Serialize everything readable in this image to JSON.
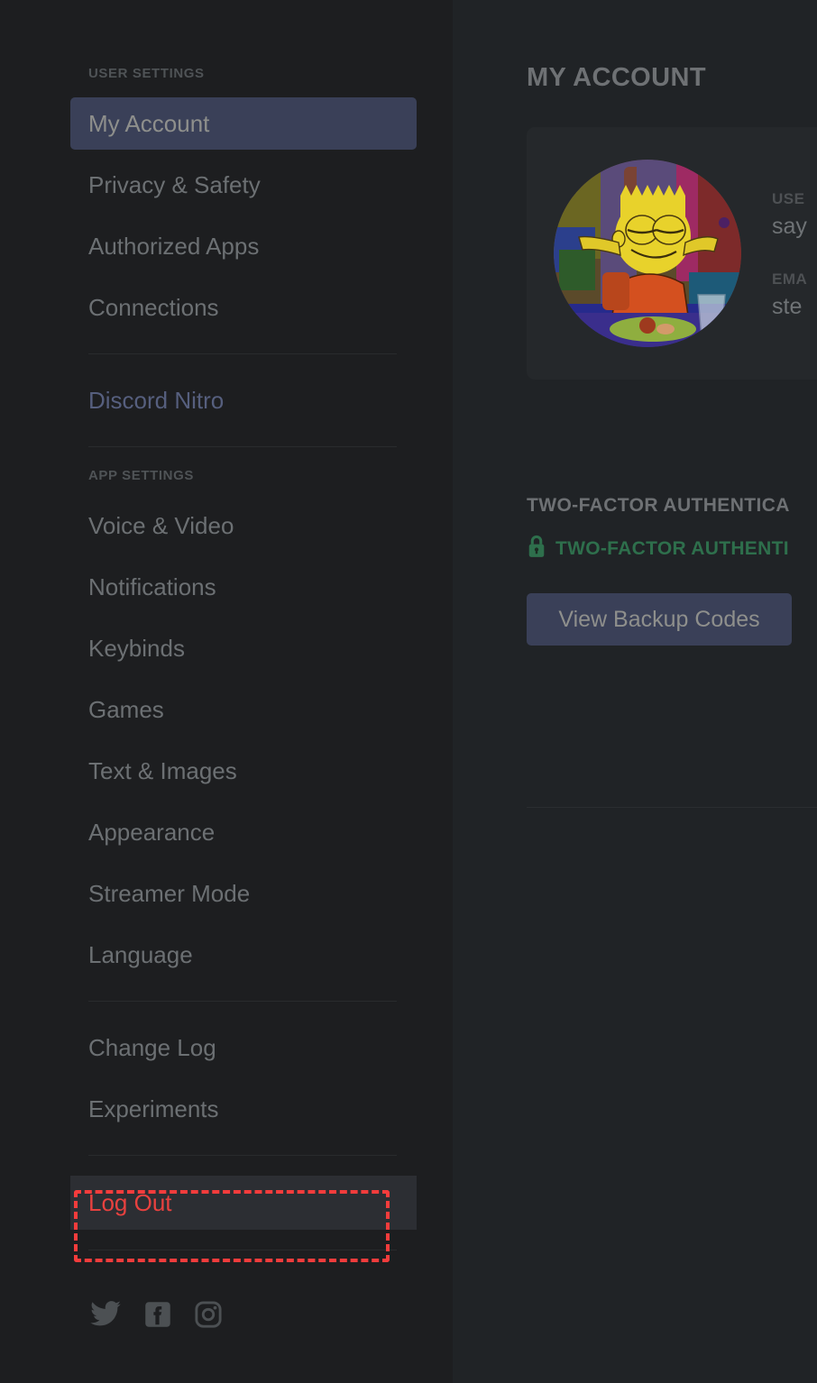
{
  "sidebar": {
    "user_settings_header": "USER SETTINGS",
    "user_settings_items": [
      {
        "label": "My Account",
        "selected": true
      },
      {
        "label": "Privacy & Safety",
        "selected": false
      },
      {
        "label": "Authorized Apps",
        "selected": false
      },
      {
        "label": "Connections",
        "selected": false
      }
    ],
    "nitro_label": "Discord Nitro",
    "app_settings_header": "APP SETTINGS",
    "app_settings_items": [
      {
        "label": "Voice & Video"
      },
      {
        "label": "Notifications"
      },
      {
        "label": "Keybinds"
      },
      {
        "label": "Games"
      },
      {
        "label": "Text & Images"
      },
      {
        "label": "Appearance"
      },
      {
        "label": "Streamer Mode"
      },
      {
        "label": "Language"
      }
    ],
    "misc_items": [
      {
        "label": "Change Log"
      },
      {
        "label": "Experiments"
      }
    ],
    "logout_label": "Log Out",
    "socials": [
      {
        "name": "twitter-icon"
      },
      {
        "name": "facebook-icon"
      },
      {
        "name": "instagram-icon"
      }
    ]
  },
  "main": {
    "title": "MY ACCOUNT",
    "account": {
      "username_label": "USE",
      "username_value": "say",
      "email_label": "EMA",
      "email_value": "ste",
      "avatar_alt": "bart-simpson-avatar"
    },
    "two_factor": {
      "section_title": "TWO-FACTOR AUTHENTICA",
      "status_label": "TWO-FACTOR AUTHENTI",
      "lock_icon": "lock-icon",
      "backup_codes_button": "View Backup Codes"
    }
  },
  "annotation": {
    "target": "Log Out",
    "color": "#f43c3c",
    "style": "dashed-rectangle"
  },
  "colors": {
    "sidebar_bg": "#1d1e20",
    "main_bg": "#202326",
    "selected_bg": "#3a4058",
    "accent_blue": "#565f7e",
    "logout_red": "#e8413f",
    "tfa_green": "#2e6f4c",
    "card_bg": "#25282b"
  }
}
